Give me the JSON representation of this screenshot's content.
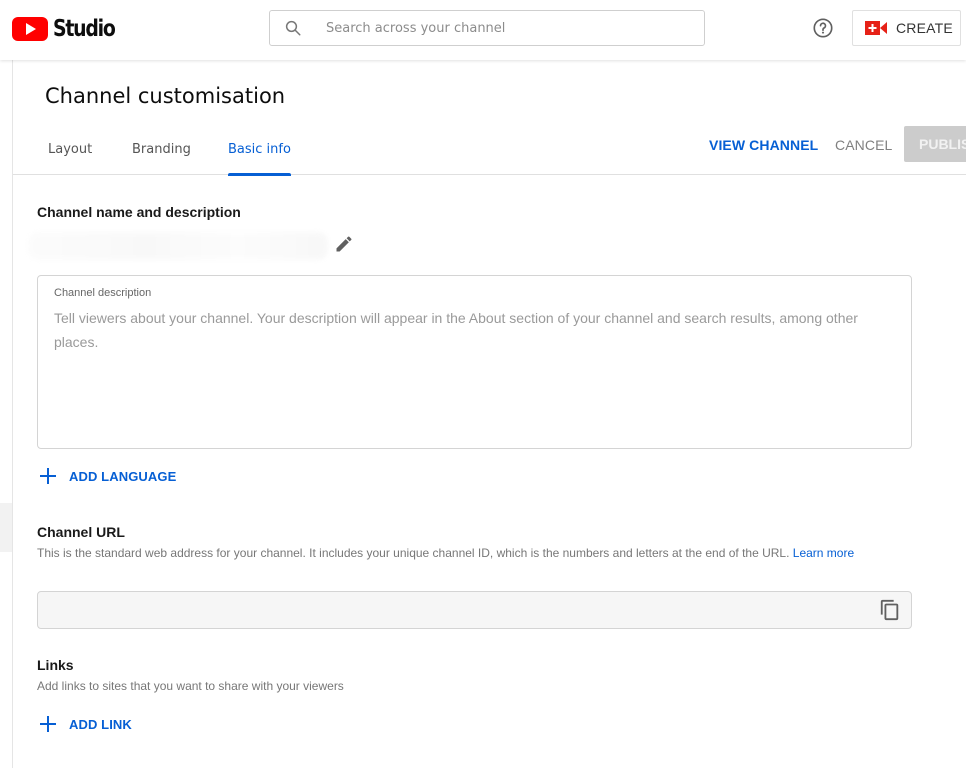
{
  "header": {
    "app_name": "Studio",
    "search_placeholder": "Search across your channel",
    "create_label": "CREATE",
    "icons": {
      "logo": "youtube-play-icon",
      "search": "search-icon",
      "help": "help-circle-icon",
      "create": "video-camera-plus-icon"
    },
    "brand_color": "#ff0000",
    "accent_color": "#065fd4"
  },
  "page": {
    "title": "Channel customisation",
    "tabs": [
      {
        "label": "Layout",
        "active": false
      },
      {
        "label": "Branding",
        "active": false
      },
      {
        "label": "Basic info",
        "active": true
      }
    ],
    "actions": {
      "view_channel": "VIEW CHANNEL",
      "cancel": "CANCEL",
      "publish": "PUBLISH"
    }
  },
  "name_section": {
    "title": "Channel name and description",
    "channel_name": "",
    "edit_icon": "pencil-icon",
    "description": {
      "label": "Channel description",
      "placeholder": "Tell viewers about your channel. Your description will appear in the About section of your channel and search results, among other places.",
      "value": ""
    },
    "add_language_label": "ADD LANGUAGE"
  },
  "url_section": {
    "title": "Channel URL",
    "description": "This is the standard web address for your channel. It includes your unique channel ID, which is the numbers and letters at the end of the URL.",
    "learn_more": "Learn more",
    "url_value": "",
    "copy_icon": "copy-icon"
  },
  "links_section": {
    "title": "Links",
    "description": "Add links to sites that you want to share with your viewers",
    "add_link_label": "ADD LINK"
  }
}
